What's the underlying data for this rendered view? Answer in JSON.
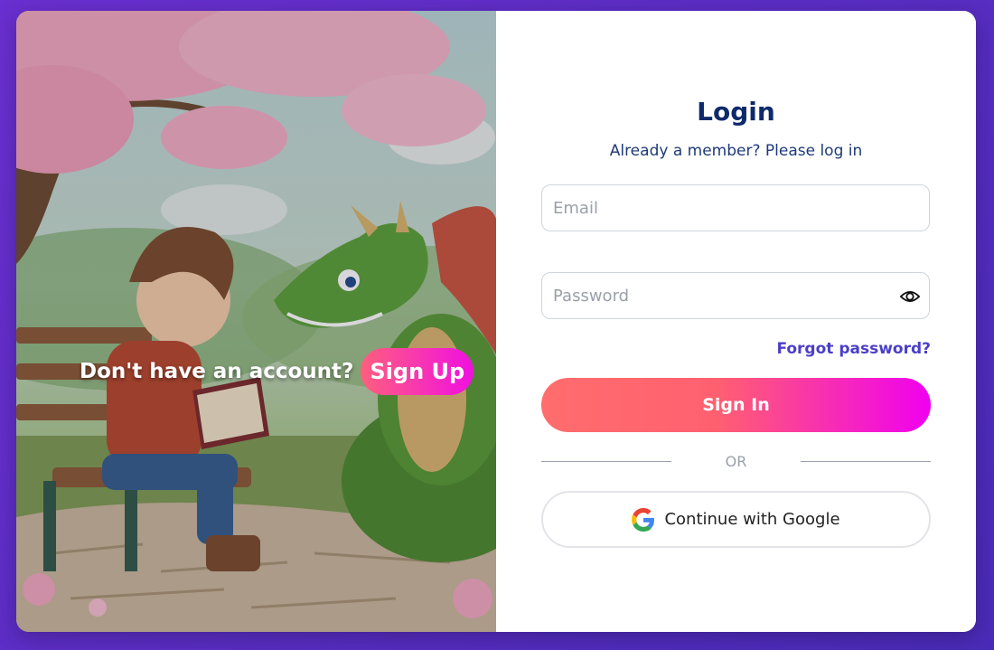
{
  "login": {
    "title": "Login",
    "subtitle": "Already a member? Please log in",
    "email_placeholder": "Email",
    "password_placeholder": "Password",
    "forgot_label": "Forgot password?",
    "signin_label": "Sign In",
    "divider_label": "OR",
    "google_label": "Continue with Google"
  },
  "promo": {
    "prompt": "Don't have an account?",
    "signup_label": "Sign Up"
  },
  "colors": {
    "accent_start": "#ff6d6d",
    "accent_end": "#f000f0",
    "title_color": "#0d2a6b",
    "link_color": "#4b3fc7"
  },
  "icons": {
    "password_toggle": "eye-icon",
    "google": "google-logo-icon"
  }
}
